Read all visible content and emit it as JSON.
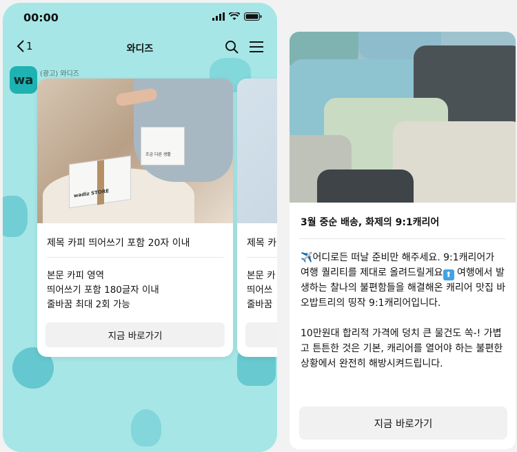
{
  "phone_left": {
    "status": {
      "time": "00:00"
    },
    "nav": {
      "back_count": "1",
      "title": "와디즈"
    },
    "ad": {
      "logo_text": "wa",
      "label": "(광고) 와디즈"
    },
    "card": {
      "box_brand": "wadiz STORE",
      "box_slogan": "조금 다른 생활",
      "title": "제목 카피 띄어쓰기 포함 20자 이내",
      "body_lines": [
        "본문 카피 영역",
        "띄어쓰기 포함 180글자 이내",
        "줄바꿈 최대 2회 가능"
      ],
      "cta": "지금 바로가기"
    },
    "peek_card": {
      "title": "제목 카",
      "body_lines": [
        "본문 카",
        "띄어쓰",
        "줄바꿈"
      ]
    }
  },
  "phone_right": {
    "title": "3월 중순 배송, 화제의 9:1캐리어",
    "body_para1_parts": [
      "✈️",
      "어디로든 떠날 준비만 해주세요. 9:1캐리어가 여행 퀄리티를 제대로 올려드릴게요",
      "⬆",
      " 여행에서 발생하는 찰나의 불편함들을 해결해온 캐리어 맛집 바오밥트리의 띵작 9:1캐리어입니다."
    ],
    "body_para2": "10만원대 합리적 가격에 덩치 큰 물건도 쏙-! 가볍고 튼튼한 것은 기본, 캐리어를 열어야 하는 불편한 상황에서 완전히 해방시켜드립니다.",
    "cta": "지금 바로가기"
  },
  "colors": {
    "phone_bg": "#a7e6e6",
    "logo_bg": "#1fb2b2",
    "button_bg": "#f1f1f1"
  }
}
